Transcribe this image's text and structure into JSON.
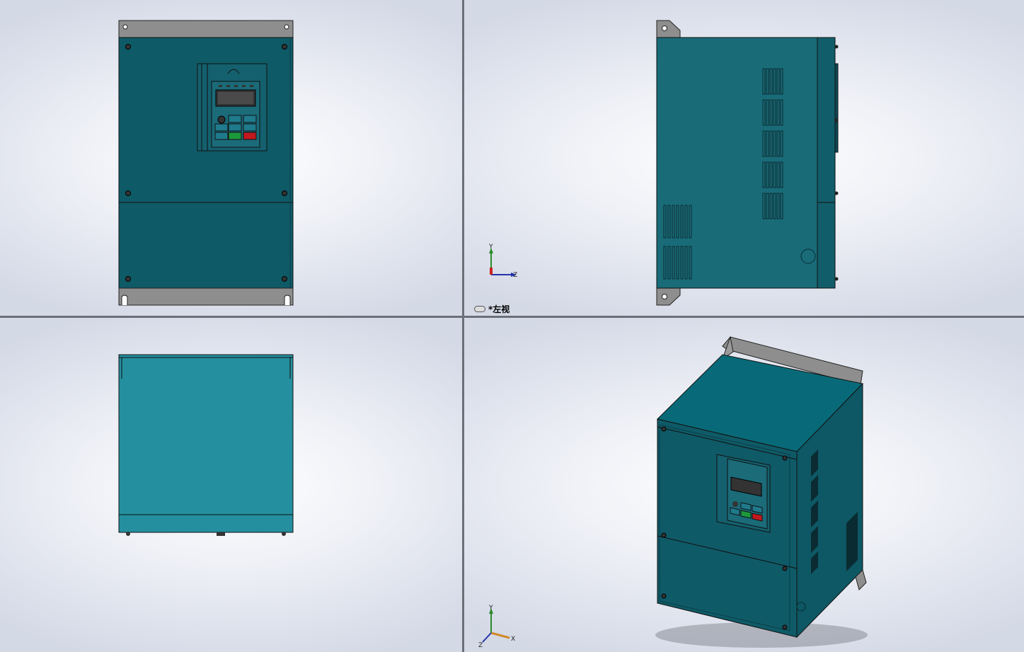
{
  "viewports": {
    "top_left": {
      "name": "front-view"
    },
    "top_right": {
      "name": "left-view",
      "label": "*左视"
    },
    "bottom_left": {
      "name": "top-view"
    },
    "bottom_right": {
      "name": "isometric-view"
    }
  },
  "axes": {
    "y": "Y",
    "z": "Z",
    "x": "X"
  },
  "colors": {
    "body_teal": "#1b6b79",
    "body_dark": "#0d5462",
    "top_teal": "#2a93a3",
    "bracket_gray": "#8c8c8c",
    "key_green": "#1c9a3b",
    "key_red": "#c2181e"
  },
  "icons": {
    "view_link": "link-icon"
  }
}
